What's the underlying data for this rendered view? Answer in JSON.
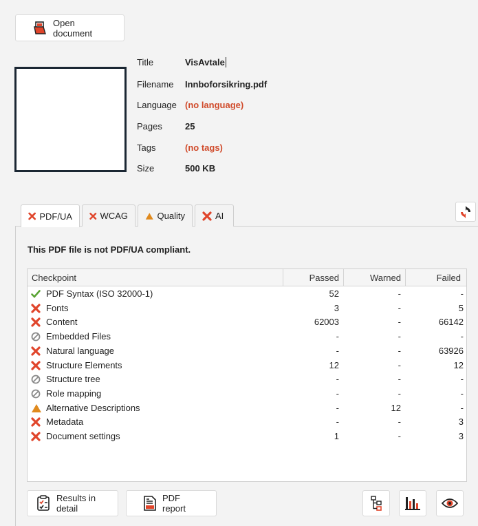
{
  "toolbar": {
    "open_label": "Open document"
  },
  "meta": {
    "title_label": "Title",
    "title_value": "VisAvtale",
    "filename_label": "Filename",
    "filename_value": "Innboforsikring.pdf",
    "language_label": "Language",
    "language_value": "(no language)",
    "pages_label": "Pages",
    "pages_value": "25",
    "tags_label": "Tags",
    "tags_value": "(no tags)",
    "size_label": "Size",
    "size_value": "500 KB"
  },
  "tabs": [
    {
      "label": "PDF/UA",
      "icon": "cross-icon",
      "active": true
    },
    {
      "label": "WCAG",
      "icon": "cross-icon",
      "active": false
    },
    {
      "label": "Quality",
      "icon": "warning-triangle-icon",
      "active": false
    },
    {
      "label": "AI",
      "icon": "cross-icon",
      "active": false
    }
  ],
  "summary": "This PDF file is not PDF/UA compliant.",
  "table": {
    "headers": {
      "checkpoint": "Checkpoint",
      "passed": "Passed",
      "warned": "Warned",
      "failed": "Failed"
    },
    "rows": [
      {
        "status": "pass",
        "name": "PDF Syntax (ISO 32000-1)",
        "passed": "52",
        "warned": "-",
        "failed": "-"
      },
      {
        "status": "fail",
        "name": "Fonts",
        "passed": "3",
        "warned": "-",
        "failed": "5"
      },
      {
        "status": "fail",
        "name": "Content",
        "passed": "62003",
        "warned": "-",
        "failed": "66142"
      },
      {
        "status": "na",
        "name": "Embedded Files",
        "passed": "-",
        "warned": "-",
        "failed": "-"
      },
      {
        "status": "fail",
        "name": "Natural language",
        "passed": "-",
        "warned": "-",
        "failed": "63926"
      },
      {
        "status": "fail",
        "name": "Structure Elements",
        "passed": "12",
        "warned": "-",
        "failed": "12"
      },
      {
        "status": "na",
        "name": "Structure tree",
        "passed": "-",
        "warned": "-",
        "failed": "-"
      },
      {
        "status": "na",
        "name": "Role mapping",
        "passed": "-",
        "warned": "-",
        "failed": "-"
      },
      {
        "status": "warn",
        "name": "Alternative Descriptions",
        "passed": "-",
        "warned": "12",
        "failed": "-"
      },
      {
        "status": "fail",
        "name": "Metadata",
        "passed": "-",
        "warned": "-",
        "failed": "3"
      },
      {
        "status": "fail",
        "name": "Document settings",
        "passed": "1",
        "warned": "-",
        "failed": "3"
      }
    ]
  },
  "footer": {
    "detail_label": "Results in detail",
    "report_label": "PDF report",
    "icons": [
      "structure-tree-icon",
      "bar-chart-icon",
      "eye-icon"
    ]
  },
  "colors": {
    "fail": "#e0452b",
    "pass": "#59a333",
    "warn": "#e08a1e",
    "na": "#8a8a8a",
    "accent_red": "#d04a2a"
  }
}
